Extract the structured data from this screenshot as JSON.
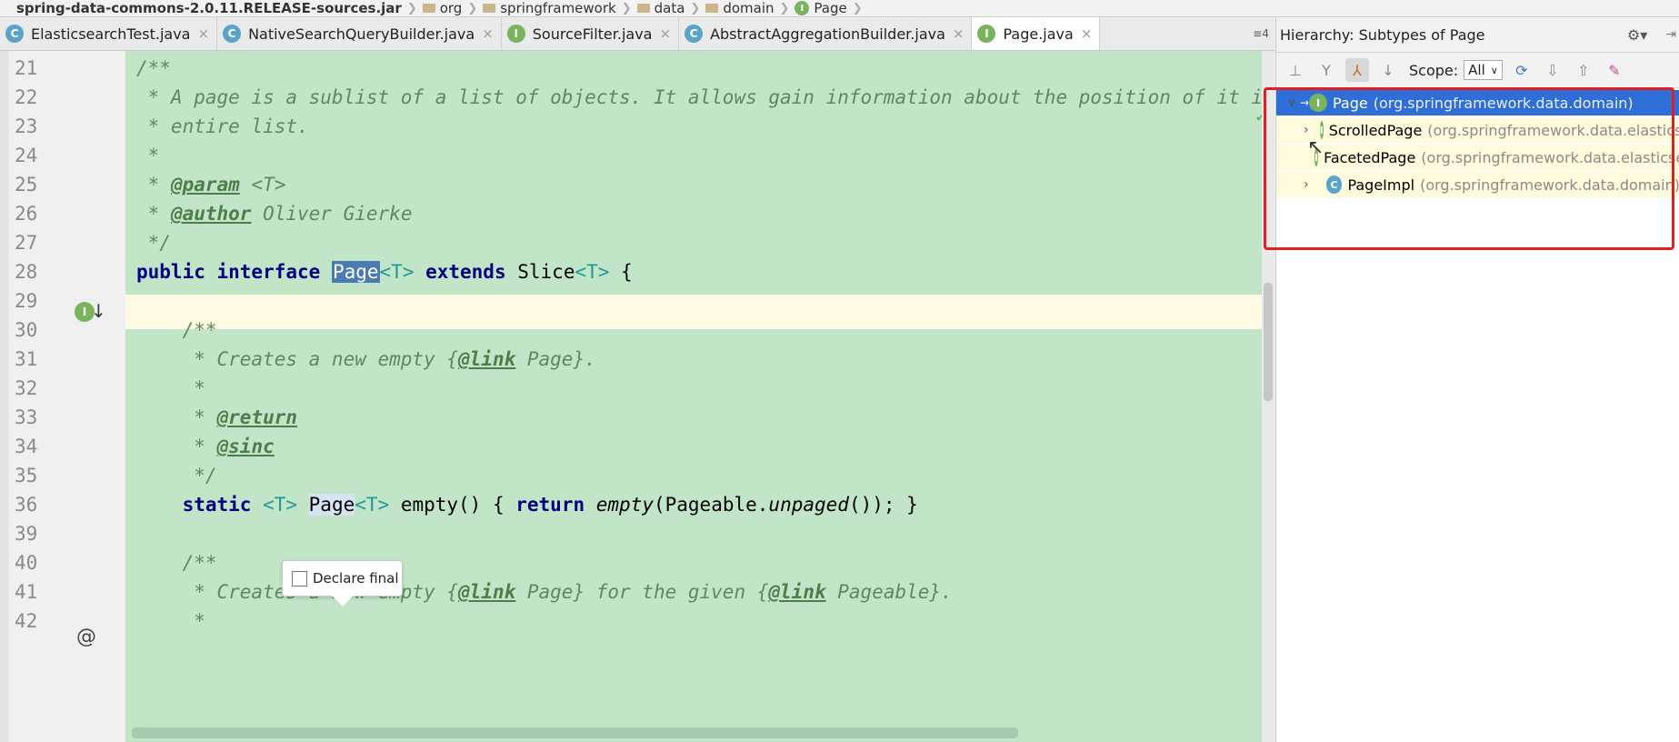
{
  "breadcrumb": {
    "jar": "spring-data-commons-2.0.11.RELEASE-sources.jar",
    "items": [
      "org",
      "springframework",
      "data",
      "domain",
      "Page"
    ]
  },
  "tabs": [
    {
      "label": "ElasticsearchTest.java",
      "icon": "class-icon",
      "active": false
    },
    {
      "label": "NativeSearchQueryBuilder.java",
      "icon": "class-icon",
      "active": false
    },
    {
      "label": "SourceFilter.java",
      "icon": "interface-icon",
      "active": false
    },
    {
      "label": "AbstractAggregationBuilder.java",
      "icon": "class-icon",
      "active": false
    },
    {
      "label": "Page.java",
      "icon": "interface-icon",
      "active": true
    }
  ],
  "tab_overflow": "≡4",
  "editor": {
    "lines": [
      {
        "num": "21",
        "text": "/**"
      },
      {
        "num": "22",
        "text": " * A page is a sublist of a list of objects. It allows gain information about the position of it in the"
      },
      {
        "num": "23",
        "text": " * entire list."
      },
      {
        "num": "24",
        "text": " *"
      },
      {
        "num": "25",
        "text_a": " * ",
        "tag": "@param",
        "text_b": " <T>"
      },
      {
        "num": "26",
        "text_a": " * ",
        "tag": "@author",
        "text_b": " Oliver Gierke"
      },
      {
        "num": "27",
        "text": " */"
      },
      {
        "num": "28",
        "kw": "public interface ",
        "name": "Page",
        "gen1": "<T>",
        "kw2": " extends ",
        "rest": "Slice",
        "gen2": "<T>",
        "end": " {"
      },
      {
        "num": "29",
        "text": ""
      },
      {
        "num": "30",
        "text": "    /**"
      },
      {
        "num": "31",
        "text_a": "     * Creates a new empty {",
        "tag": "@link",
        "text_b": " Page}."
      },
      {
        "num": "32",
        "text": "     *"
      },
      {
        "num": "33",
        "text_a": "     * ",
        "tag": "@return",
        "text_b": ""
      },
      {
        "num": "34",
        "text_a": "     * ",
        "tag": "@sinc",
        "text_b": ""
      },
      {
        "num": "35",
        "text": "     */"
      },
      {
        "num": "36",
        "kw": "    static ",
        "gen1": "<T> ",
        "name": "Page",
        "gen2": "<T>",
        "mid": " empty() { ",
        "kw2": "return ",
        "call": "empty",
        "args": "(Pageable.",
        "call2": "unpaged",
        "end": "()); }"
      },
      {
        "num": "39",
        "text": ""
      },
      {
        "num": "40",
        "text": "    /**"
      },
      {
        "num": "41",
        "text_a": "     * Creates a new empty {",
        "tag": "@link",
        "text_b": " Page} for the given {",
        "tag2": "@link",
        "text_c": " Pageable}."
      },
      {
        "num": "42",
        "text": "     *"
      }
    ]
  },
  "popup": {
    "label": "Declare final"
  },
  "hierarchy": {
    "title": "Hierarchy: Subtypes of Page",
    "scope_label": "Scope:",
    "scope_value": "All",
    "nodes": [
      {
        "name": "Page",
        "pkg": "(org.springframework.data.domain)",
        "kind": "interface",
        "expand": "",
        "selected": true
      },
      {
        "name": "ScrolledPage",
        "pkg": "(org.springframework.data.elasticsearch.core)",
        "kind": "interface",
        "expand": "›",
        "selected": false
      },
      {
        "name": "FacetedPage",
        "pkg": "(org.springframework.data.elasticsearch.core)",
        "kind": "interface",
        "expand": "",
        "selected": false
      },
      {
        "name": "PageImpl",
        "pkg": "(org.springframework.data.domain)",
        "kind": "class",
        "expand": "›",
        "selected": false
      }
    ]
  }
}
